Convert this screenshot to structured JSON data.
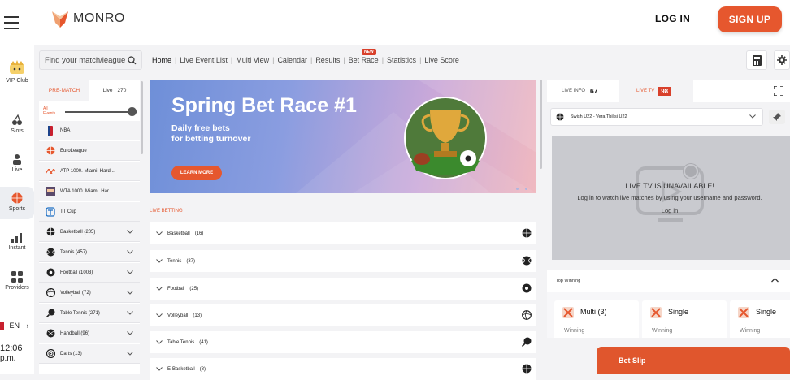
{
  "header": {
    "logo_text": "MONRO",
    "login_label": "LOG IN",
    "signup_label": "SIGN UP",
    "accent_color": "#e6572e"
  },
  "rail": [
    {
      "label": "VIP Club",
      "icon": "crown-icon"
    },
    {
      "label": "Slots",
      "icon": "cherries-icon"
    },
    {
      "label": "Live",
      "icon": "person-icon"
    },
    {
      "label": "Sports",
      "icon": "basketball-icon",
      "active": true
    },
    {
      "label": "Instant",
      "icon": "chart-icon"
    },
    {
      "label": "Providers",
      "icon": "grid-icon"
    }
  ],
  "language": "EN",
  "clock": {
    "time": "12:06",
    "period": "p.m."
  },
  "search": {
    "placeholder": "Find your match/league"
  },
  "nav": {
    "items": [
      "Home",
      "Live Event List",
      "Multi View",
      "Calendar",
      "Results",
      "Bet Race",
      "Statistics",
      "Live Score"
    ],
    "new_badge": "NEW"
  },
  "sport_panel": {
    "tab_prematch": "PRE-MATCH",
    "tab_live": "Live",
    "tab_live_count": "270",
    "all_events_line1": "All",
    "all_events_line2": "Events",
    "leagues": [
      "NBA",
      "EuroLeague",
      "ATP 1000. Miami. Hard...",
      "WTA 1000. Miami. Har...",
      "TT Cup"
    ],
    "sports": [
      {
        "name": "Basketball",
        "count": "(205)"
      },
      {
        "name": "Tennis",
        "count": "(457)"
      },
      {
        "name": "Football",
        "count": "(1003)"
      },
      {
        "name": "Volleyball",
        "count": "(72)"
      },
      {
        "name": "Table Tennis",
        "count": "(271)"
      },
      {
        "name": "Handball",
        "count": "(96)"
      },
      {
        "name": "Darts",
        "count": "(13)"
      }
    ]
  },
  "banner": {
    "title": "Spring Bet Race #1",
    "subtitle_line1": "Daily free bets",
    "subtitle_line2": "for betting turnover",
    "button": "LEARN MORE"
  },
  "live_betting": {
    "title": "LIVE BETTING",
    "rows": [
      {
        "name": "Basketball",
        "count": "(16)"
      },
      {
        "name": "Tennis",
        "count": "(37)"
      },
      {
        "name": "Football",
        "count": "(25)"
      },
      {
        "name": "Volleyball",
        "count": "(13)"
      },
      {
        "name": "Table Tennis",
        "count": "(41)"
      },
      {
        "name": "E-Basketball",
        "count": "(8)"
      }
    ]
  },
  "right_panel": {
    "live_info_label": "LIVE INFO",
    "live_info_count": "67",
    "live_tv_label": "LIVE TV",
    "live_tv_count": "98",
    "match": "Swish U22 - Vera Tbilisi U22",
    "tv_title": "LIVE TV IS UNAVAILABLE!",
    "tv_message": "Log in to watch live matches by using your username and password.",
    "tv_login": "Log in",
    "top_winning_title": "Top Winning",
    "wins": [
      {
        "type": "Multi",
        "count": "(3)",
        "label": "Winning"
      },
      {
        "type": "Single",
        "count": "",
        "label": "Winning"
      },
      {
        "type": "Single",
        "count": "",
        "label": "Winning"
      }
    ],
    "bet_slip": "Bet Slip"
  }
}
